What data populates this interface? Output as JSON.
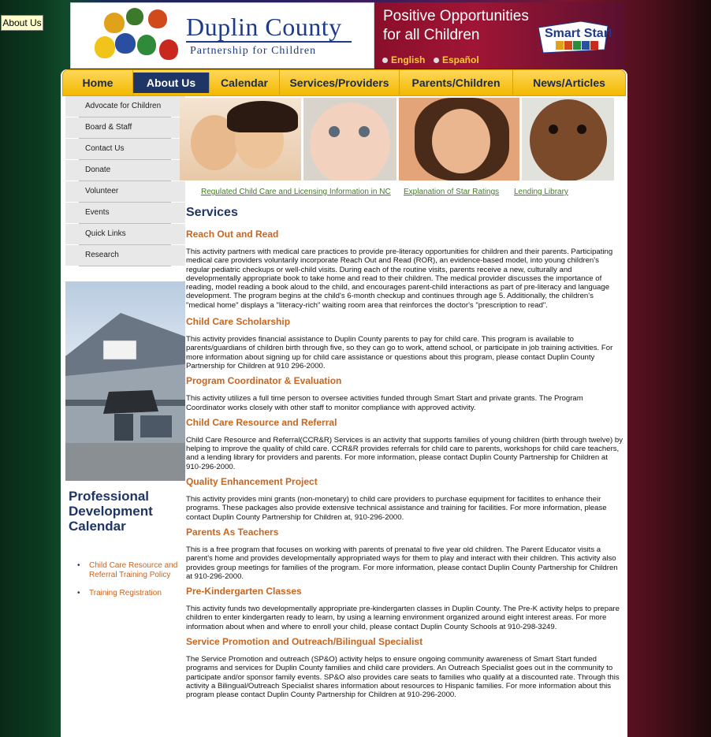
{
  "tooltip": "About Us",
  "header": {
    "logo_title": "Duplin County",
    "logo_subtitle": "Partnership for Children",
    "promo_line1": "Positive Opportunities",
    "promo_line2": "for all Children",
    "smart_start": "Smart Start",
    "lang_english": "English",
    "lang_spanish": "Español"
  },
  "nav": {
    "items": [
      "Home",
      "About Us",
      "Calendar",
      "Services/Providers",
      "Parents/Children",
      "News/Articles"
    ],
    "active": "About Us"
  },
  "sidebar": {
    "items": [
      "Advocate for Children",
      "Board & Staff",
      "Contact Us",
      "Donate",
      "Volunteer",
      "Events",
      "Quick Links",
      "Research"
    ]
  },
  "pd": {
    "title": "Professional Development Calendar",
    "links": [
      "Child Care Resource and Referral Training Policy",
      "Training Registration"
    ]
  },
  "links": [
    "Regulated Child Care and Licensing Information in NC",
    "Explanation of Star Ratings",
    "Lending Library"
  ],
  "content": {
    "title": "Services",
    "sections": [
      {
        "heading": "Reach Out and Read",
        "body": "This activity partners with medical care practices to provide pre-literacy opportunities for children and their parents. Participating medical care providers voluntarily incorporate Reach Out and Read (ROR), an evidence-based model, into young children's regular pediatric checkups or well-child visits. During each of the routine visits, parents receive a new, culturally and developmentally appropriate book to take home and read to their children. The medical provider discusses the importance of reading, model reading a book aloud to the child, and encourages parent-child interactions as part of pre-literacy and language development. The program begins at the child's 6-month checkup and continues through age 5. Additionally, the children's \"medical home\" displays a \"literacy-rich\" waiting room area that reinforces the doctor's \"prescription to read\"."
      },
      {
        "heading": "Child Care Scholarship",
        "body": "This activity provides financial assistance to Duplin County parents to pay for child care. This program is available to parents/guardians of children birth through five, so they can go to work, attend school, or participate in job training activities. For more information about signing up for child care assistance or questions about this program, please contact Duplin County Partnership for Children at 910 296-2000."
      },
      {
        "heading": "Program Coordinator & Evaluation",
        "body": "This activity utilizes a full time person to oversee activities funded through Smart Start and private grants. The Program Coordinator works closely with other staff to monitor compliance with approved activity."
      },
      {
        "heading": "Child Care Resource and Referral",
        "body": "Child Care Resource and Referral(CCR&R) Services is an activity that supports families of young children (birth through twelve) by helping to improve the quality of child care. CCR&R provides referrals for child care to parents, workshops for child care teachers, and a lending library for providers and parents. For more information, please contact Duplin County Partnership for Children at 910-296-2000."
      },
      {
        "heading": "Quality Enhancement Project",
        "body": "This activity provides mini grants (non-monetary) to child care providers to purchase equipment for facitlites to enhance their programs. These packages also provide extensive technical assistance and training for facilities. For more information, please contact Duplin County Partnership for Children at, 910-296-2000."
      },
      {
        "heading": "Parents As Teachers",
        "body": "This is a free program that focuses on working with parents of prenatal to five year old children. The Parent Educator visits a parent's home and provides developmentally appropriated ways for them to play and interact with their children. This activity also provides group meetings for families of the program. For more information, please contact Duplin County Partnership for Children at 910-296-2000."
      },
      {
        "heading": "Pre-Kindergarten Classes",
        "body": "This activity funds two developmentally appropriate pre-kindergarten classes in Duplin County.  The Pre-K activity helps to prepare children to enter kindergarten ready to learn, by using a learning environment organized around eight interest areas.  For more information about when and where to enroll your child, please contact Duplin County Schools at 910-298-3249."
      },
      {
        "heading": "Service Promotion and Outreach/Bilingual Specialist",
        "body": "The Service Promotion and outreach (SP&O) activity helps to ensure ongoing community awareness of Smart Start funded programs and services for Duplin County families and child care providers. An Outreach Specialist goes out in the community to participate and/or sponsor family events.  SP&O also provides care seats to families who qualify at a discounted rate. Through this activity a Bilingual/Outreach Specialist shares information about resources to Hispanic families.  For more information about this program please contact Duplin County Partnership for Children at 910-296-2000."
      }
    ]
  }
}
